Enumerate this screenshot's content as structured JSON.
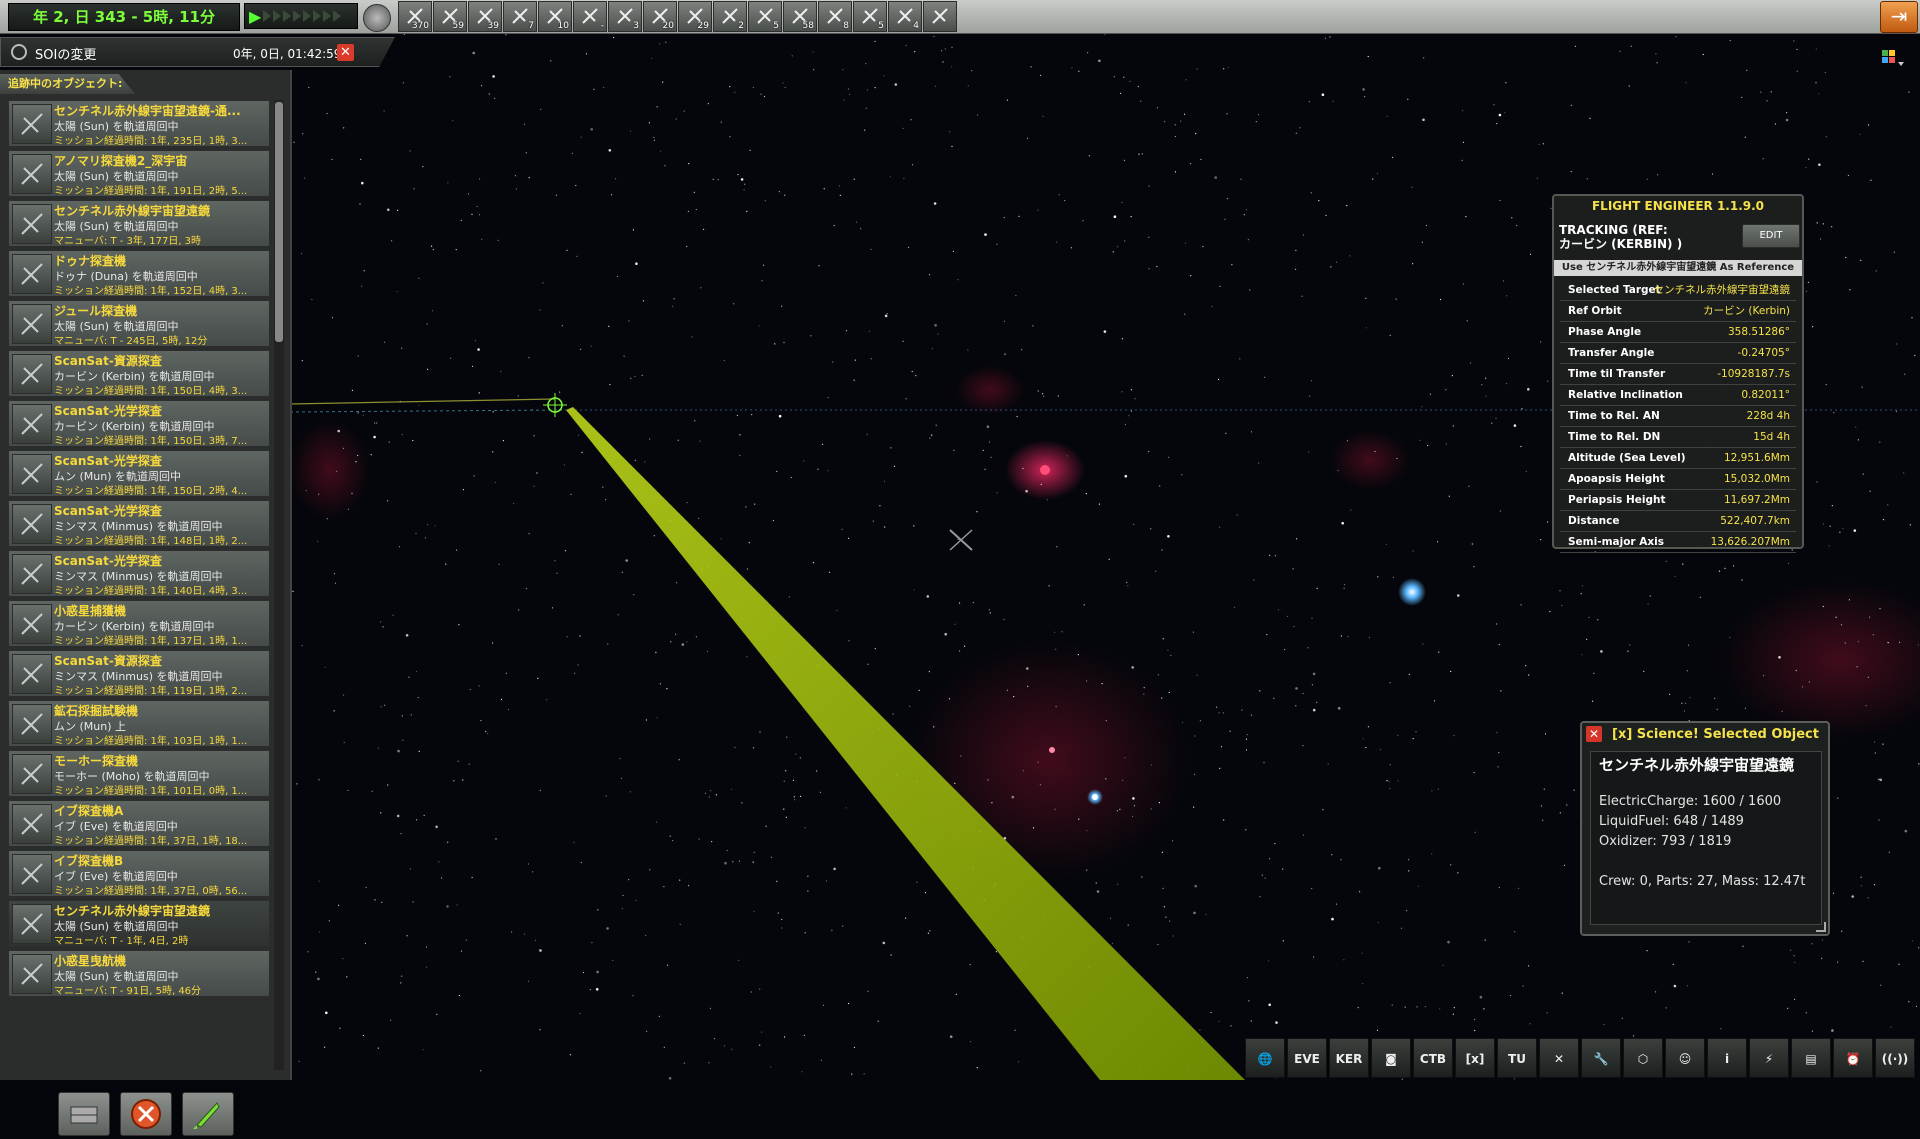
{
  "topbar": {
    "date": "年 2, 日 343 - 5時, 11分",
    "filters": [
      {
        "icon": "probe-icon",
        "count": "370"
      },
      {
        "icon": "ship-icon",
        "count": "59"
      },
      {
        "icon": "relay-icon",
        "count": "39"
      },
      {
        "icon": "station-icon",
        "count": "7"
      },
      {
        "icon": "lander-icon",
        "count": "10"
      },
      {
        "icon": "debris-icon",
        "count": "-"
      },
      {
        "icon": "rover-icon",
        "count": "3"
      },
      {
        "icon": "plane-icon",
        "count": "20"
      },
      {
        "icon": "base-icon",
        "count": "29"
      },
      {
        "icon": "eva-icon",
        "count": "2"
      },
      {
        "icon": "flag-icon",
        "count": "5"
      },
      {
        "icon": "asteroid-icon",
        "count": "58"
      },
      {
        "icon": "unknown-icon",
        "count": "8"
      },
      {
        "icon": "deployed-icon",
        "count": "5"
      },
      {
        "icon": "sciencepart-icon",
        "count": "4"
      },
      {
        "icon": "collapse-icon",
        "count": ""
      }
    ]
  },
  "soi": {
    "label": "SOIの変更",
    "time": "0年, 0日, 01:42:59"
  },
  "tracking": {
    "header": "追跡中のオブジェクト:",
    "items": [
      {
        "name": "センチネル赤外線宇宙望遠鏡-通...",
        "loc": "太陽 (Sun) を軌道周回中",
        "met": "ミッション経過時間: 1年, 235日, 1時, 3..."
      },
      {
        "name": "アノマリ探査機2_深宇宙",
        "loc": "太陽 (Sun) を軌道周回中",
        "met": "ミッション経過時間: 1年, 191日, 2時, 5..."
      },
      {
        "name": "センチネル赤外線宇宙望遠鏡",
        "loc": "太陽 (Sun) を軌道周回中",
        "met": "マニューバ: T - 3年, 177日, 3時"
      },
      {
        "name": "ドゥナ探査機",
        "loc": "ドゥナ (Duna) を軌道周回中",
        "met": "ミッション経過時間: 1年, 152日, 4時, 3..."
      },
      {
        "name": "ジュール探査機",
        "loc": "太陽 (Sun) を軌道周回中",
        "met": "マニューバ: T - 245日, 5時, 12分"
      },
      {
        "name": "ScanSat-資源探査",
        "loc": "カービン (Kerbin) を軌道周回中",
        "met": "ミッション経過時間: 1年, 150日, 4時, 3..."
      },
      {
        "name": "ScanSat-光学探査",
        "loc": "カービン (Kerbin) を軌道周回中",
        "met": "ミッション経過時間: 1年, 150日, 3時, 7..."
      },
      {
        "name": "ScanSat-光学探査",
        "loc": "ムン (Mun) を軌道周回中",
        "met": "ミッション経過時間: 1年, 150日, 2時, 4..."
      },
      {
        "name": "ScanSat-光学探査",
        "loc": "ミンマス (Minmus) を軌道周回中",
        "met": "ミッション経過時間: 1年, 148日, 1時, 2..."
      },
      {
        "name": "ScanSat-光学探査",
        "loc": "ミンマス (Minmus) を軌道周回中",
        "met": "ミッション経過時間: 1年, 140日, 4時, 3..."
      },
      {
        "name": "小惑星捕獲機",
        "loc": "カービン (Kerbin) を軌道周回中",
        "met": "ミッション経過時間: 1年, 137日, 1時, 1..."
      },
      {
        "name": "ScanSat-資源探査",
        "loc": "ミンマス (Minmus) を軌道周回中",
        "met": "ミッション経過時間: 1年, 119日, 1時, 2..."
      },
      {
        "name": "鉱石採掘試験機",
        "loc": "ムン (Mun) 上",
        "met": "ミッション経過時間: 1年, 103日, 1時, 1..."
      },
      {
        "name": "モーホー探査機",
        "loc": "モーホー (Moho) を軌道周回中",
        "met": "ミッション経過時間: 1年, 101日, 0時, 1..."
      },
      {
        "name": "イブ探査機A",
        "loc": "イブ (Eve) を軌道周回中",
        "met": "ミッション経過時間: 1年, 37日, 1時, 18..."
      },
      {
        "name": "イブ探査機B",
        "loc": "イブ (Eve) を軌道周回中",
        "met": "ミッション経過時間: 1年, 37日, 0時, 56..."
      },
      {
        "name": "センチネル赤外線宇宙望遠鏡",
        "loc": "太陽 (Sun) を軌道周回中",
        "met": "マニューバ: T - 1年, 4日, 2時"
      },
      {
        "name": "小惑星曳航機",
        "loc": "太陽 (Sun) を軌道周回中",
        "met": "マニューバ: T - 91日, 5時, 46分"
      }
    ]
  },
  "ke": {
    "title": "FLIGHT ENGINEER 1.1.9.0",
    "tracking_line1": "TRACKING (REF:",
    "tracking_line2": "カービン (KERBIN) )",
    "edit": "EDIT",
    "use_ref": "Use センチネル赤外線宇宙望遠鏡 As Reference",
    "rows": [
      {
        "k": "Selected Target",
        "v": "センチネル赤外線宇宙望遠鏡"
      },
      {
        "k": "Ref Orbit",
        "v": "カービン (Kerbin)"
      },
      {
        "k": "Phase Angle",
        "v": "358.51286°"
      },
      {
        "k": "Transfer Angle",
        "v": "-0.24705°"
      },
      {
        "k": "Time til Transfer",
        "v": "-10928187.7s"
      },
      {
        "k": "Relative Inclination",
        "v": "0.82011°"
      },
      {
        "k": "Time to Rel. AN",
        "v": "228d 4h"
      },
      {
        "k": "Time to Rel. DN",
        "v": "15d 4h"
      },
      {
        "k": "Altitude (Sea Level)",
        "v": "12,951.6Mm"
      },
      {
        "k": "Apoapsis Height",
        "v": "15,032.0Mm"
      },
      {
        "k": "Periapsis Height",
        "v": "11,697.2Mm"
      },
      {
        "k": "Distance",
        "v": "522,407.7km"
      },
      {
        "k": "Semi-major Axis",
        "v": "13,626.207Mm"
      }
    ]
  },
  "science": {
    "title": "[x] Science! Selected Object",
    "object": "センチネル赤外線宇宙望遠鏡",
    "ec": "ElectricCharge: 1600 / 1600",
    "lf": "LiquidFuel: 648 / 1489",
    "ox": "Oxidizer: 793 / 1819",
    "crew": "Crew: 0, Parts: 27, Mass: 12.47t"
  },
  "apptools": [
    {
      "icon": "globe-icon",
      "label": "🌐"
    },
    {
      "icon": "eve-icon",
      "label": "EVE"
    },
    {
      "icon": "ker-icon",
      "label": "KER"
    },
    {
      "icon": "camera-icon",
      "label": "◙"
    },
    {
      "icon": "ctb-icon",
      "label": "CTB"
    },
    {
      "icon": "science-x-icon",
      "label": "[x]"
    },
    {
      "icon": "tutx-icon",
      "label": "TU"
    },
    {
      "icon": "crossed-icon",
      "label": "✕"
    },
    {
      "icon": "wrench-icon",
      "label": "🔧"
    },
    {
      "icon": "hex-icon",
      "label": "⬡"
    },
    {
      "icon": "kerbal-icon",
      "label": "☺"
    },
    {
      "icon": "info-icon",
      "label": "i"
    },
    {
      "icon": "mechjeb-icon",
      "label": "⚡"
    },
    {
      "icon": "notes-icon",
      "label": "▤"
    },
    {
      "icon": "alarm-icon",
      "label": "⏰"
    },
    {
      "icon": "antenna-icon",
      "label": "((·))"
    }
  ]
}
